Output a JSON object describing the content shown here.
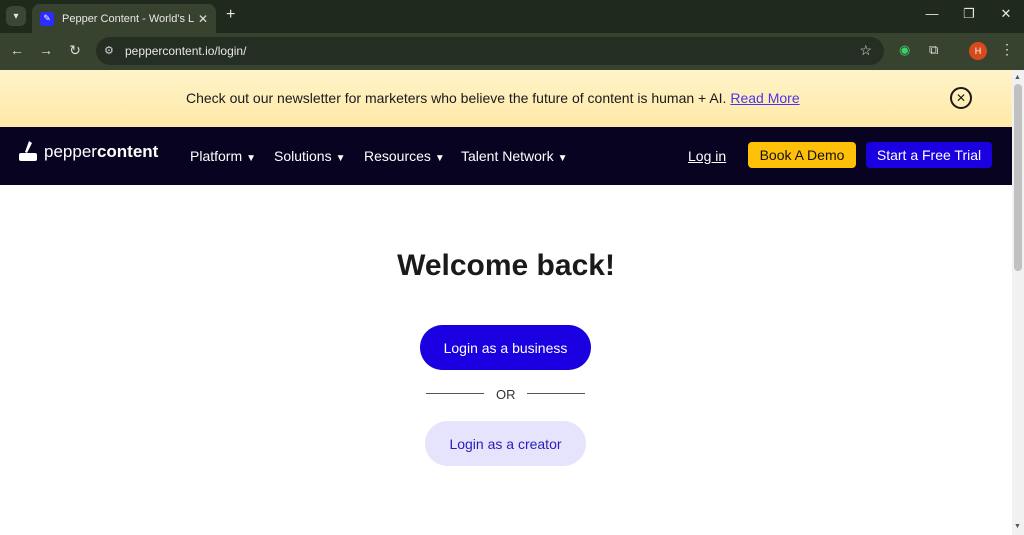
{
  "browser": {
    "tab_title": "Pepper Content - World's Large",
    "tab_close": "✕",
    "new_tab": "+",
    "url": "peppercontent.io/login/",
    "avatar_letter": "H",
    "icons": [
      "tab-search-icon",
      "favicon-icon",
      "back-icon",
      "forward-icon",
      "reload-icon",
      "site-info-icon",
      "star-icon",
      "extension-icon",
      "puzzle-icon",
      "menu-icon",
      "minimize-icon",
      "restore-icon",
      "close-icon"
    ]
  },
  "announcement": {
    "text": "Check out our newsletter for marketers who believe the future of content is human + AI.",
    "link": "Read More",
    "close": "✕"
  },
  "navbar": {
    "logo_prefix": "pepper",
    "logo_suffix": "content",
    "items": [
      {
        "label": "Platform"
      },
      {
        "label": "Solutions"
      },
      {
        "label": "Resources"
      },
      {
        "label": "Talent Network"
      }
    ],
    "login": "Log in",
    "demo": "Book A Demo",
    "trial": "Start a Free Trial"
  },
  "main": {
    "heading": "Welcome back!",
    "business_button": "Login as a business",
    "or": "OR",
    "creator_button": "Login as a creator"
  },
  "colors": {
    "brand_blue": "#1a00e0",
    "nav_bg": "#080320",
    "demo_yellow": "#ffc107",
    "banner_bg": "#fff3c9",
    "creator_bg": "#e6e3fc"
  }
}
